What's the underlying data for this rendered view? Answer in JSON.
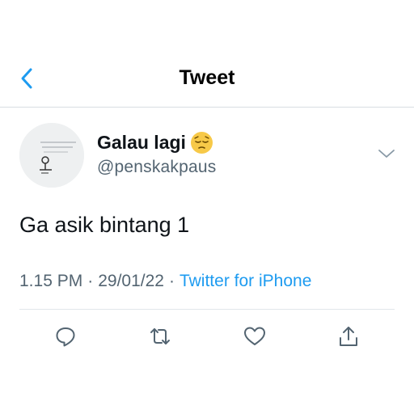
{
  "header": {
    "title": "Tweet",
    "back_icon": "chevron-left-icon",
    "accent_color": "#1d9bf0"
  },
  "tweet": {
    "display_name": "Galau lagi",
    "emoji_icon": "pensive-face-emoji",
    "handle": "@penskakpaus",
    "text": "Ga asik bintang 1",
    "time": "1.15 PM",
    "date": "29/01/22",
    "separator": "·",
    "source": "Twitter for iPhone"
  },
  "actions": {
    "items": [
      "reply-icon",
      "retweet-icon",
      "like-icon",
      "share-icon"
    ]
  }
}
